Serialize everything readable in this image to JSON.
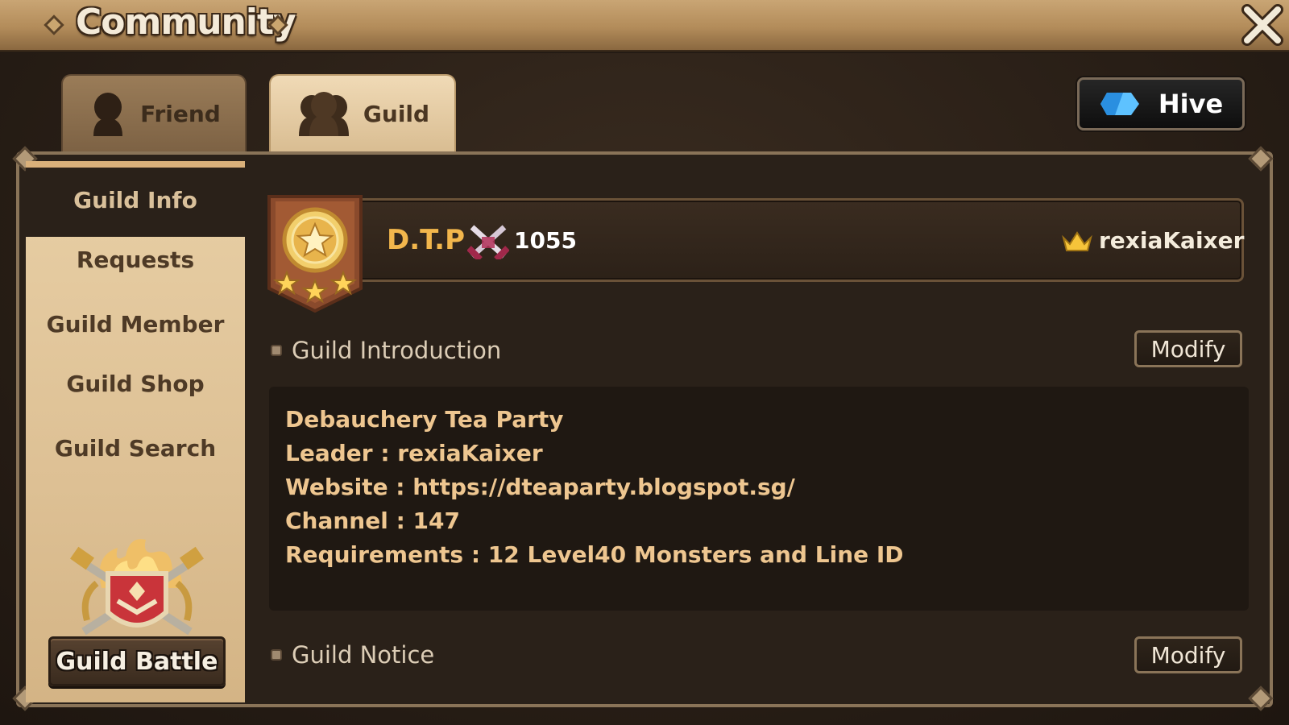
{
  "window": {
    "title": "Community"
  },
  "tabs": [
    {
      "label": "Friend",
      "icon": "friend-silhouette-icon",
      "active": false
    },
    {
      "label": "Guild",
      "icon": "guild-silhouette-icon",
      "active": true
    }
  ],
  "hive": {
    "label": "Hive",
    "icon": "hive-logo-icon",
    "accent": "#3aa8ff"
  },
  "sidebar": {
    "items": [
      {
        "label": "Guild Info",
        "active": true
      },
      {
        "label": "Requests"
      },
      {
        "label": "Guild Member"
      },
      {
        "label": "Guild Shop"
      },
      {
        "label": "Guild Search"
      }
    ],
    "guild_battle": {
      "label": "Guild Battle",
      "icon": "guild-battle-emblem-icon"
    }
  },
  "guild": {
    "name": "D.T.P",
    "points": "1055",
    "leader": "rexiaKaixer",
    "badge_stars": 3,
    "name_color": "#f2b64c"
  },
  "introduction": {
    "heading": "Guild Introduction",
    "modify_label": "Modify",
    "lines": [
      "Debauchery Tea Party",
      "Leader : rexiaKaixer",
      "Website : https://dteaparty.blogspot.sg/",
      "Channel : 147",
      "Requirements : 12 Level40 Monsters and Line ID"
    ]
  },
  "notice": {
    "heading": "Guild Notice",
    "modify_label": "Modify"
  }
}
